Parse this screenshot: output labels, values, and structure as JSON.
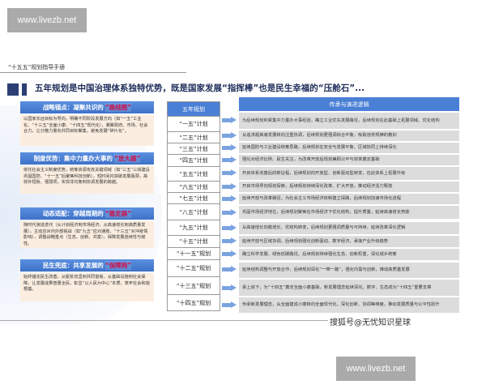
{
  "watermarks": {
    "top": "www.livezb.net",
    "bottom": "www.livezb.net",
    "sohu": "搜狐号@无忧知识星球"
  },
  "doc_label": "“十五五”规划指导手册",
  "title": "五年规划是中国治理体系独特优势，既是国家发展“指挥棒”也是民生幸福的“压舱石”...",
  "left_boxes": [
    {
      "heading": "战略锚点：凝聚共识的",
      "highlight": "“路线图”",
      "body": "以国家长远目标为导向，明确不同阶段发展方向（如“一五”工业化、“十三五”全面小康、“十四五”现代化），凝聚政府、市场、社会合力，让分散力量向共同目标聚集，避免发展“碎片化”。"
    },
    {
      "heading": "制度优势：集中力量办大事的",
      "highlight": "“放大器”",
      "body": "依托社会主义制度优势，统筹资源攻克关键领域（如“三五”三线建设巩固国防、“十一五”后聚焦科技创新），短时间内突破发展瓶颈，高效补短板、强弱项，实现非均衡到协调发展的跨越。"
    },
    {
      "heading": "动态适配：穿越周期的",
      "highlight": "“稳定器”",
      "body": "随时代演进迭代（从计划经济到市场经济，从高速增长到高质量发展），主动应对内外部挑战（如“九五”应对通胀、“十三五”对冲疫情影响），调整战略重点（生态、创新、共富），保障发展连续性与韧性。"
    },
    {
      "heading": "民生兜底：共享发展的",
      "highlight": "“保障网”",
      "body": "始终锚定民生改善，从脱贫攻坚到共同富裕，从基础设施到社会保障，让发展成果普惠全民，彰显“以人民为中心”本质，筑牢社会和谐根基。"
    }
  ],
  "plan_header": "五年规划",
  "logic_header": "传承与演进逻辑",
  "plans": [
    {
      "name": "“一五”计划",
      "logic": "为后续规划积累集中力量办大事经验，确立工业优先发展路径，后续规划在此基础上拓展领域、优化结构"
    },
    {
      "name": "“二五”计划",
      "logic": "从追求超高速发展转向注重协调，后续规划更强调综合平衡，吸取违背规律的教训"
    },
    {
      "name": "“三五”计划",
      "logic": "延续国防与工业建设统筹思路，后续规划在安全与发展平衡、区域协同上持续深化"
    },
    {
      "name": "“四五”计划",
      "logic": "强化对经济比例、民生关注，为改革开放后规划兼顾公平与效率奠定基础"
    },
    {
      "name": "“五五”计划",
      "logic": "开启体系完善后的新征程，后续规划向开放型、创新驱动型转变，在此体系上拓展升级"
    },
    {
      "name": "“六五”计划",
      "logic": "开启市场导向规划探索，后续规划持续深化改革、扩大开放，推动经济活力释放"
    },
    {
      "name": "“七五”计划",
      "logic": "延续开放与改革路径，为社会主义市场经济体制建立探路，后续规划加速市场化进程"
    },
    {
      "name": "“八五”计划",
      "logic": "巩固市场经济地位，后续规划聚焦在市场经济下优化结构，提升质量，延续高速增长势能"
    },
    {
      "name": "“九五”计划",
      "logic": "从高速增长向稳增长、优结构转变，后续规划更强调质量与可持续，延续改革深化逻辑"
    },
    {
      "name": "“十五”计划",
      "logic": "延续开放与区域协调，后续规划强化创新驱动、数字经济，承接产业升级趋势"
    },
    {
      "name": "“十一五”规划",
      "logic": "确立科学发展、绿色低碳路径，后续规划持续强化生态、创新权重，深化城乡统筹"
    },
    {
      "name": "“十二五”规划",
      "logic": "延续结构调整与开放合作，后续规划深化“一带一路”，强化内需与创新，推动高质量发展"
    },
    {
      "name": "“十三五”规划",
      "logic": "承上启下，为“十四五”奠定全面小康基础，新发展理念延续深化，数字、生态成为“十四五”重要支撑"
    },
    {
      "name": "“十四五”规划",
      "logic": "传承新发展理念，从全面建成小康转向全面现代化，深化创新、协调等维度，推动发展质量与公平性跃升"
    }
  ]
}
